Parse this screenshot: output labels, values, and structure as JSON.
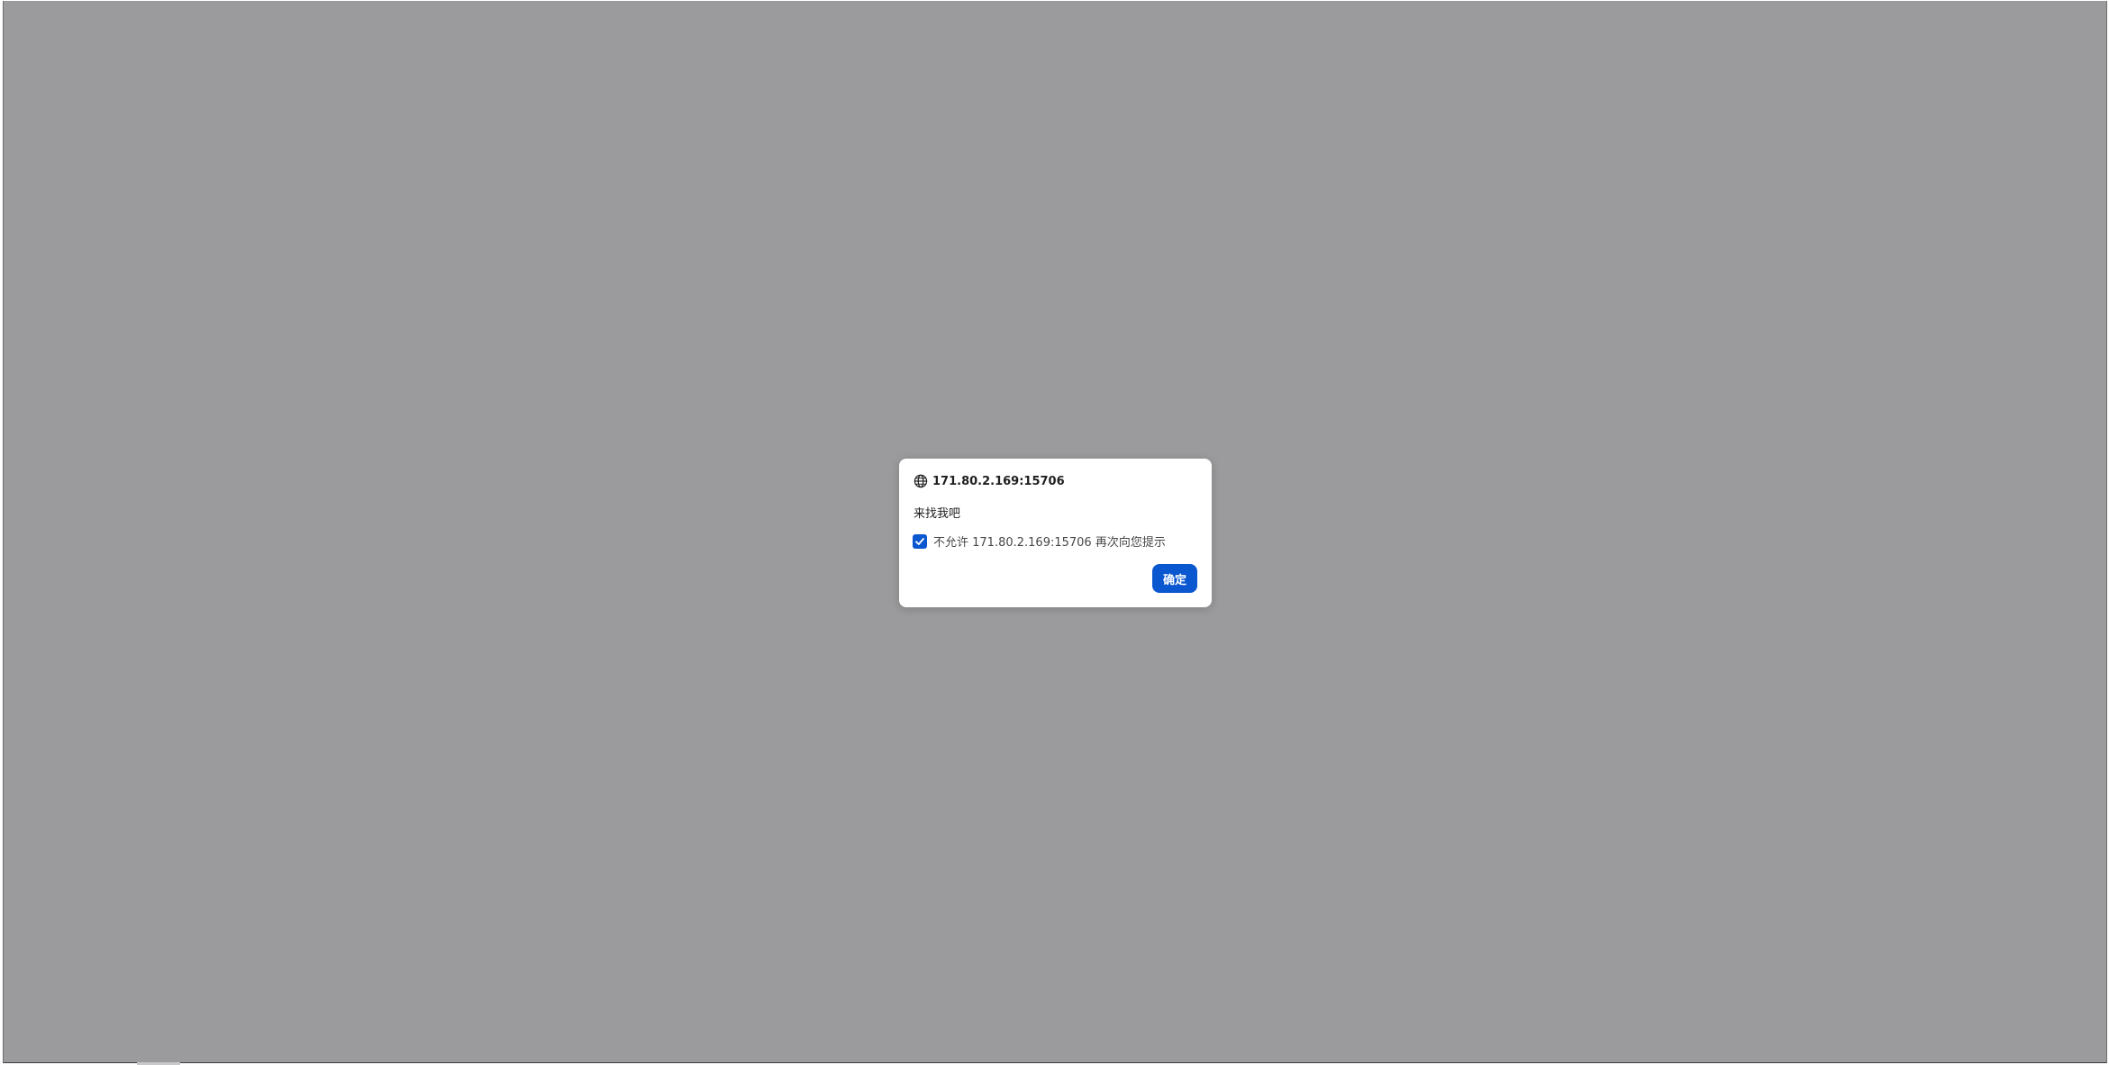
{
  "dialog": {
    "origin": "171.80.2.169:15706",
    "origin_icon": "globe-icon",
    "message": "来找我吧",
    "suppress_checkbox": {
      "checked": true,
      "label": "不允许 171.80.2.169:15706 再次向您提示"
    },
    "ok_label": "确定"
  },
  "colors": {
    "overlay": "#9b9b9d",
    "accent": "#0b57d0",
    "dialog_background": "#ffffff"
  }
}
